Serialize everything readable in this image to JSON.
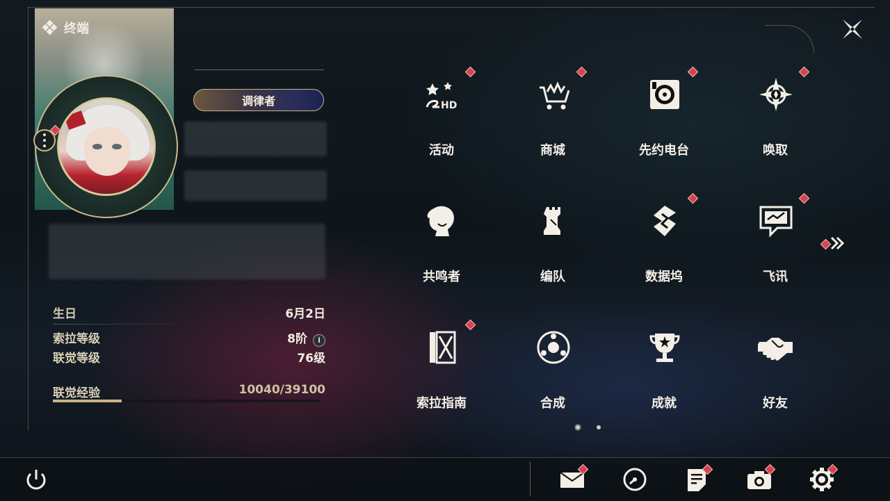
{
  "window": {
    "title": "终端"
  },
  "profile": {
    "title_badge": "调律者",
    "stats": [
      {
        "label": "生日",
        "value": "6月2日"
      },
      {
        "label": "索拉等级",
        "value": "8阶"
      },
      {
        "label": "联觉等级",
        "value": "76级"
      }
    ],
    "exp": {
      "label": "联觉经验",
      "value": "10040/39100",
      "progress": 0.2568
    }
  },
  "menu": {
    "items": [
      {
        "label": "活动",
        "icon": "event-2hd-icon",
        "badge": true
      },
      {
        "label": "商城",
        "icon": "shop-cart-icon",
        "badge": true
      },
      {
        "label": "先约电台",
        "icon": "radio-icon",
        "badge": true
      },
      {
        "label": "唤取",
        "icon": "summon-compass-icon",
        "badge": true
      },
      {
        "label": "共鸣者",
        "icon": "resonator-head-icon",
        "badge": false
      },
      {
        "label": "编队",
        "icon": "chess-team-icon",
        "badge": false
      },
      {
        "label": "数据坞",
        "icon": "data-bank-icon",
        "badge": true
      },
      {
        "label": "飞讯",
        "icon": "chat-message-icon",
        "badge": true
      },
      {
        "label": "索拉指南",
        "icon": "guide-book-icon",
        "badge": true
      },
      {
        "label": "合成",
        "icon": "synthesis-icon",
        "badge": false
      },
      {
        "label": "成就",
        "icon": "trophy-icon",
        "badge": false
      },
      {
        "label": "好友",
        "icon": "handshake-icon",
        "badge": false
      }
    ],
    "pages": 2,
    "current_page": 1
  },
  "bottom_bar": {
    "buttons": [
      {
        "name": "mail",
        "icon": "mail-icon",
        "badge": true
      },
      {
        "name": "timer",
        "icon": "clock-icon",
        "badge": false
      },
      {
        "name": "notes",
        "icon": "notes-icon",
        "badge": true
      },
      {
        "name": "camera",
        "icon": "camera-icon",
        "badge": true
      },
      {
        "name": "settings",
        "icon": "gear-icon",
        "badge": true
      }
    ]
  },
  "colors": {
    "accent": "#c9b78a",
    "badge": "#d9414f",
    "text": "#f3efe6"
  }
}
